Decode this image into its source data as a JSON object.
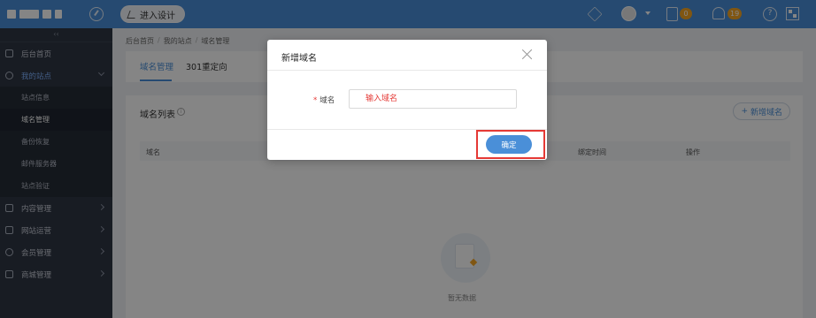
{
  "topbar": {
    "design_button": "进入设计",
    "task_badge": "0",
    "notice_badge": "19",
    "help_glyph": "?",
    "icons": [
      "dashboard-icon",
      "send-icon",
      "avatar",
      "clipboard-icon",
      "bell-icon",
      "help-icon",
      "qr-code-icon"
    ]
  },
  "sidebar": {
    "collapse_glyph": "‹‹",
    "items": [
      {
        "label": "后台首页",
        "icon": "home-icon"
      },
      {
        "label": "我的站点",
        "icon": "globe-icon"
      },
      {
        "label": "内容管理",
        "icon": "document-icon"
      },
      {
        "label": "网站运营",
        "icon": "monitor-icon"
      },
      {
        "label": "会员管理",
        "icon": "users-icon"
      },
      {
        "label": "商城管理",
        "icon": "shop-icon"
      }
    ],
    "sub_items": [
      "站点信息",
      "域名管理",
      "备份恢复",
      "邮件服务器",
      "站点验证"
    ]
  },
  "breadcrumb": [
    "后台首页",
    "我的站点",
    "域名管理"
  ],
  "tabs": [
    "域名管理",
    "301重定向"
  ],
  "content": {
    "list_title": "域名列表",
    "add_button": "新增域名",
    "columns": [
      "域名",
      "绑定时间",
      "操作"
    ],
    "empty_text": "暂无数据"
  },
  "modal": {
    "title": "新增域名",
    "required_mark": "*",
    "field_label": "域名",
    "placeholder": "输入域名",
    "confirm": "确定"
  },
  "colors": {
    "accent": "#4a8fd8",
    "sidebar": "#2f3644",
    "highlight": "#e53935",
    "badge": "#f5a623"
  }
}
